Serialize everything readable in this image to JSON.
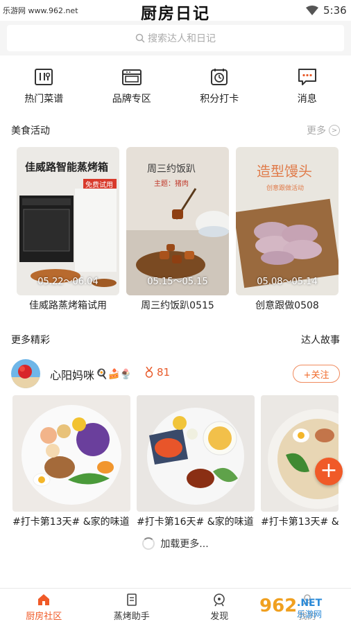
{
  "status_bar": {
    "watermark": "乐游网 www.962.net",
    "app_title": "厨房日记",
    "time": "5:36"
  },
  "search": {
    "placeholder": "搜索达人和日记",
    "icon": "search-icon"
  },
  "shortcuts": [
    {
      "label": "热门菜谱",
      "icon": "menu-board-icon"
    },
    {
      "label": "品牌专区",
      "icon": "oven-icon"
    },
    {
      "label": "积分打卡",
      "icon": "alarm-clock-icon"
    },
    {
      "label": "消息",
      "icon": "chat-bubble-icon"
    }
  ],
  "activities_section": {
    "title": "美食活动",
    "more_label": "更多",
    "more_icon": ">"
  },
  "activities": [
    {
      "banner": "佳威路智能蒸烤箱",
      "tag": "免费试用",
      "date": "05.22～06.04",
      "caption": "佳威路蒸烤箱试用"
    },
    {
      "banner": "周三约饭趴",
      "sub": "主题：猪肉",
      "date": "05.15～05.15",
      "caption": "周三约饭趴0515"
    },
    {
      "banner": "造型馒头",
      "sub": "创意跟做活动",
      "date": "05.08～05.14",
      "caption": "创意跟做0508"
    }
  ],
  "featured_section": {
    "title": "更多精彩",
    "right_label": "达人故事"
  },
  "user": {
    "name": "心阳妈咪",
    "emoji": "🍳🍰🍨",
    "medal_count": "81",
    "follow_label": "+关注"
  },
  "diaries": [
    {
      "caption": "#打卡第13天# &家的味道"
    },
    {
      "caption": "#打卡第16天# &家的味道"
    },
    {
      "caption": "#打卡第13天# &家的味道"
    }
  ],
  "fab": {
    "label": "+"
  },
  "loading_text": "加载更多...",
  "tabs": [
    {
      "label": "厨房社区",
      "active": true,
      "icon": "home-icon"
    },
    {
      "label": "蒸烤助手",
      "active": false,
      "icon": "notebook-icon"
    },
    {
      "label": "发现",
      "active": false,
      "icon": "discover-icon"
    },
    {
      "label": "我的",
      "active": false,
      "icon": "profile-icon"
    }
  ],
  "colors": {
    "accent": "#f05a28",
    "text": "#222222",
    "muted": "#aaaaaa"
  }
}
